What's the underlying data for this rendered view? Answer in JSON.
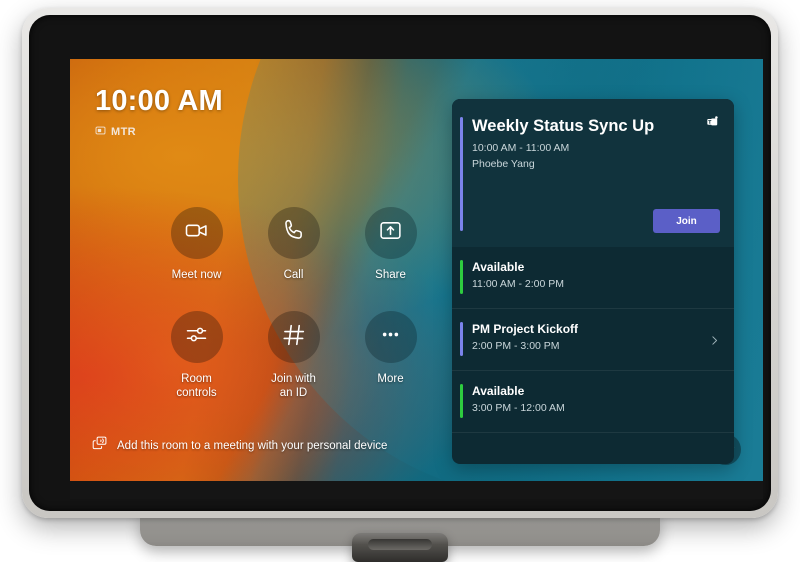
{
  "device": {
    "type": "touch-console",
    "chassis_color": "#d9d8d5",
    "bezel_color": "#131313",
    "stand_color": "#a9a7a3"
  },
  "theme": {
    "accent_purple": "#5b5fc7",
    "meeting_accent": "#7b83eb",
    "available_accent": "#2ecc3f",
    "panel_bg": "#0d2a33",
    "featured_bg": "#11333d",
    "wallpaper_warm": "#cf6a0b",
    "wallpaper_cool": "#0f6b82"
  },
  "home": {
    "clock": "10:00 AM",
    "room_label": "MTR",
    "room_icon": "room-device-icon",
    "bottom_hint": {
      "icon": "cast-device-icon",
      "text": "Add this room to a meeting with your personal device"
    },
    "help": {
      "icon": "help-question-icon",
      "label": "?"
    },
    "actions": [
      {
        "label": "Meet now",
        "icon": "video-camera-icon",
        "tone": "warm"
      },
      {
        "label": "Call",
        "icon": "phone-icon",
        "tone": "warm"
      },
      {
        "label": "Share",
        "icon": "share-screen-icon",
        "tone": "cool"
      },
      {
        "label": "Room\ncontrols",
        "icon": "sliders-icon",
        "tone": "warm"
      },
      {
        "label": "Join with\nan ID",
        "icon": "hash-icon",
        "tone": "warm"
      },
      {
        "label": "More",
        "icon": "ellipsis-icon",
        "tone": "cool"
      }
    ]
  },
  "agenda": {
    "featured": {
      "title": "Weekly Status Sync Up",
      "time": "10:00 AM - 11:00 AM",
      "organizer": "Phoebe Yang",
      "app_icon": "teams-icon",
      "join_label": "Join",
      "accent": "#7b83eb"
    },
    "rows": [
      {
        "title": "Available",
        "time": "11:00 AM - 2:00 PM",
        "accent": "#2ecc3f",
        "chevron": false
      },
      {
        "title": "PM Project Kickoff",
        "time": "2:00 PM - 3:00 PM",
        "accent": "#7b83eb",
        "chevron": true
      },
      {
        "title": "Available",
        "time": "3:00 PM - 12:00 AM",
        "accent": "#2ecc3f",
        "chevron": false
      }
    ]
  }
}
